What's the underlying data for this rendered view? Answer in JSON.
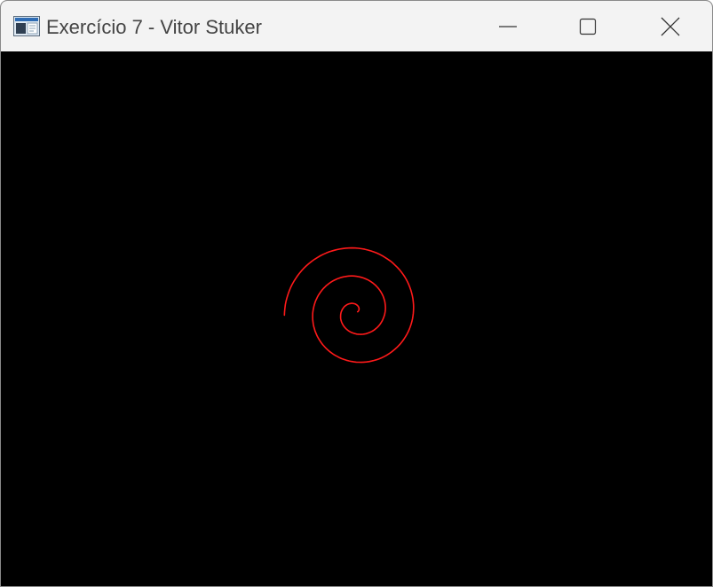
{
  "window": {
    "title": "Exercício 7 - Vitor Stuker",
    "app_icon": "application-window-icon",
    "controls": {
      "minimize_icon": "minimize-icon",
      "maximize_icon": "maximize-icon",
      "close_icon": "close-icon"
    }
  },
  "canvas": {
    "background_color": "#000000",
    "spiral": {
      "color": "#ff1a1a",
      "shape": "archimedean-spiral",
      "turns": 2.5
    }
  }
}
